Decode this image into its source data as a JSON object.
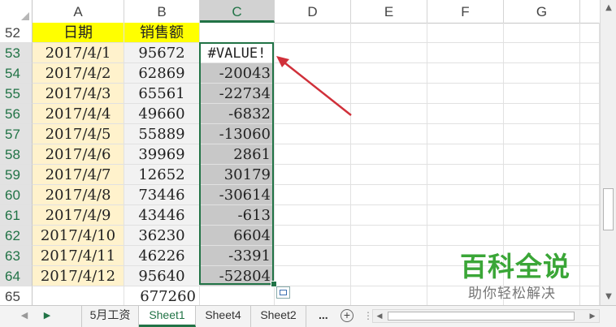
{
  "columns": [
    "A",
    "B",
    "C",
    "D",
    "E",
    "F",
    "G"
  ],
  "active_column": "C",
  "header_row": {
    "row": "52",
    "date_header": "日期",
    "sales_header": "销售额"
  },
  "rows": [
    {
      "row": "53",
      "date": "2017/4/1",
      "sales": "95672",
      "diff": "#VALUE!"
    },
    {
      "row": "54",
      "date": "2017/4/2",
      "sales": "62869",
      "diff": "-20043"
    },
    {
      "row": "55",
      "date": "2017/4/3",
      "sales": "65561",
      "diff": "-22734"
    },
    {
      "row": "56",
      "date": "2017/4/4",
      "sales": "49660",
      "diff": "-6832"
    },
    {
      "row": "57",
      "date": "2017/4/5",
      "sales": "55889",
      "diff": "-13060"
    },
    {
      "row": "58",
      "date": "2017/4/6",
      "sales": "39969",
      "diff": "2861"
    },
    {
      "row": "59",
      "date": "2017/4/7",
      "sales": "12652",
      "diff": "30179"
    },
    {
      "row": "60",
      "date": "2017/4/8",
      "sales": "73446",
      "diff": "-30614"
    },
    {
      "row": "61",
      "date": "2017/4/9",
      "sales": "43446",
      "diff": "-613"
    },
    {
      "row": "62",
      "date": "2017/4/10",
      "sales": "36230",
      "diff": "6604"
    },
    {
      "row": "63",
      "date": "2017/4/11",
      "sales": "46226",
      "diff": "-3391"
    },
    {
      "row": "64",
      "date": "2017/4/12",
      "sales": "95640",
      "diff": "-52804"
    }
  ],
  "total_row": {
    "row": "65",
    "total": "677260"
  },
  "tabs": [
    "5月工资",
    "Sheet1",
    "Sheet4",
    "Sheet2"
  ],
  "active_tab": "Sheet1",
  "tab_more": "...",
  "add_sheet": "+",
  "watermark": {
    "title": "百科全说",
    "subtitle": "助你轻松解决"
  },
  "colors": {
    "accent": "#217346",
    "header_fill": "#ffff00",
    "date_fill": "#fff2cc",
    "selection_fill": "#c8c8c8",
    "arrow": "#d0303a"
  }
}
